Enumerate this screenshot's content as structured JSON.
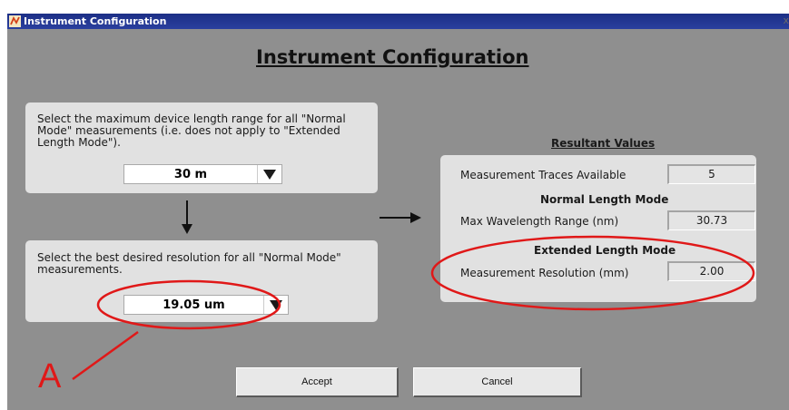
{
  "window": {
    "title": "Instrument Configuration",
    "close_glyph": "x"
  },
  "heading": "Instrument Configuration",
  "length_panel": {
    "text_lines": [
      "Select the maximum device length range for all \"Normal",
      "Mode\" measurements (i.e. does not apply to \"Extended",
      "Length Mode\")."
    ],
    "dropdown_value": "30 m"
  },
  "resolution_panel": {
    "text_lines": [
      "Select the best desired resolution for all \"Normal Mode\"",
      "measurements."
    ],
    "dropdown_value": "19.05 um"
  },
  "results": {
    "heading": "Resultant Values",
    "traces_label": "Measurement Traces Available",
    "traces_value": "5",
    "normal_heading": "Normal Length Mode",
    "wavelength_label": "Max Wavelength Range (nm)",
    "wavelength_value": "30.73",
    "extended_heading": "Extended Length Mode",
    "resolution_label": "Measurement Resolution (mm)",
    "resolution_value": "2.00"
  },
  "buttons": {
    "accept": "Accept",
    "cancel": "Cancel"
  },
  "annotation": {
    "letter": "A",
    "color": "#e01818"
  }
}
